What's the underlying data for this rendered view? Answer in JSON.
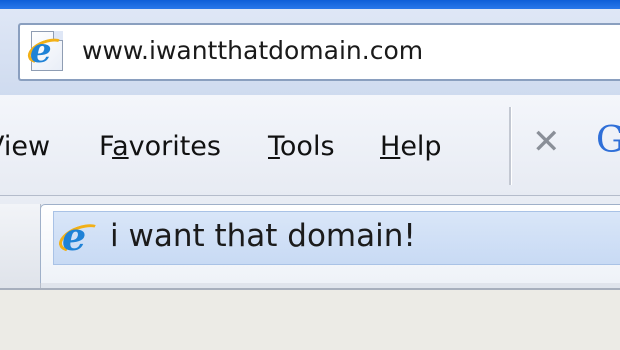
{
  "address_bar": {
    "url": "www.iwantthatdomain.com",
    "icon": "ie-page-icon"
  },
  "menu": {
    "items": [
      {
        "label": "View"
      },
      {
        "label": "Favorites"
      },
      {
        "label": "Tools"
      },
      {
        "label": "Help"
      }
    ],
    "close_glyph": "✕",
    "search_glyph": "G"
  },
  "tab": {
    "title": "i want that domain!",
    "icon": "ie-icon"
  },
  "colors": {
    "title_bar": "#0f5fd8",
    "tab_highlight": "#c8daf4",
    "ie_blue": "#1f82d6",
    "ie_ring": "#f2b016"
  }
}
